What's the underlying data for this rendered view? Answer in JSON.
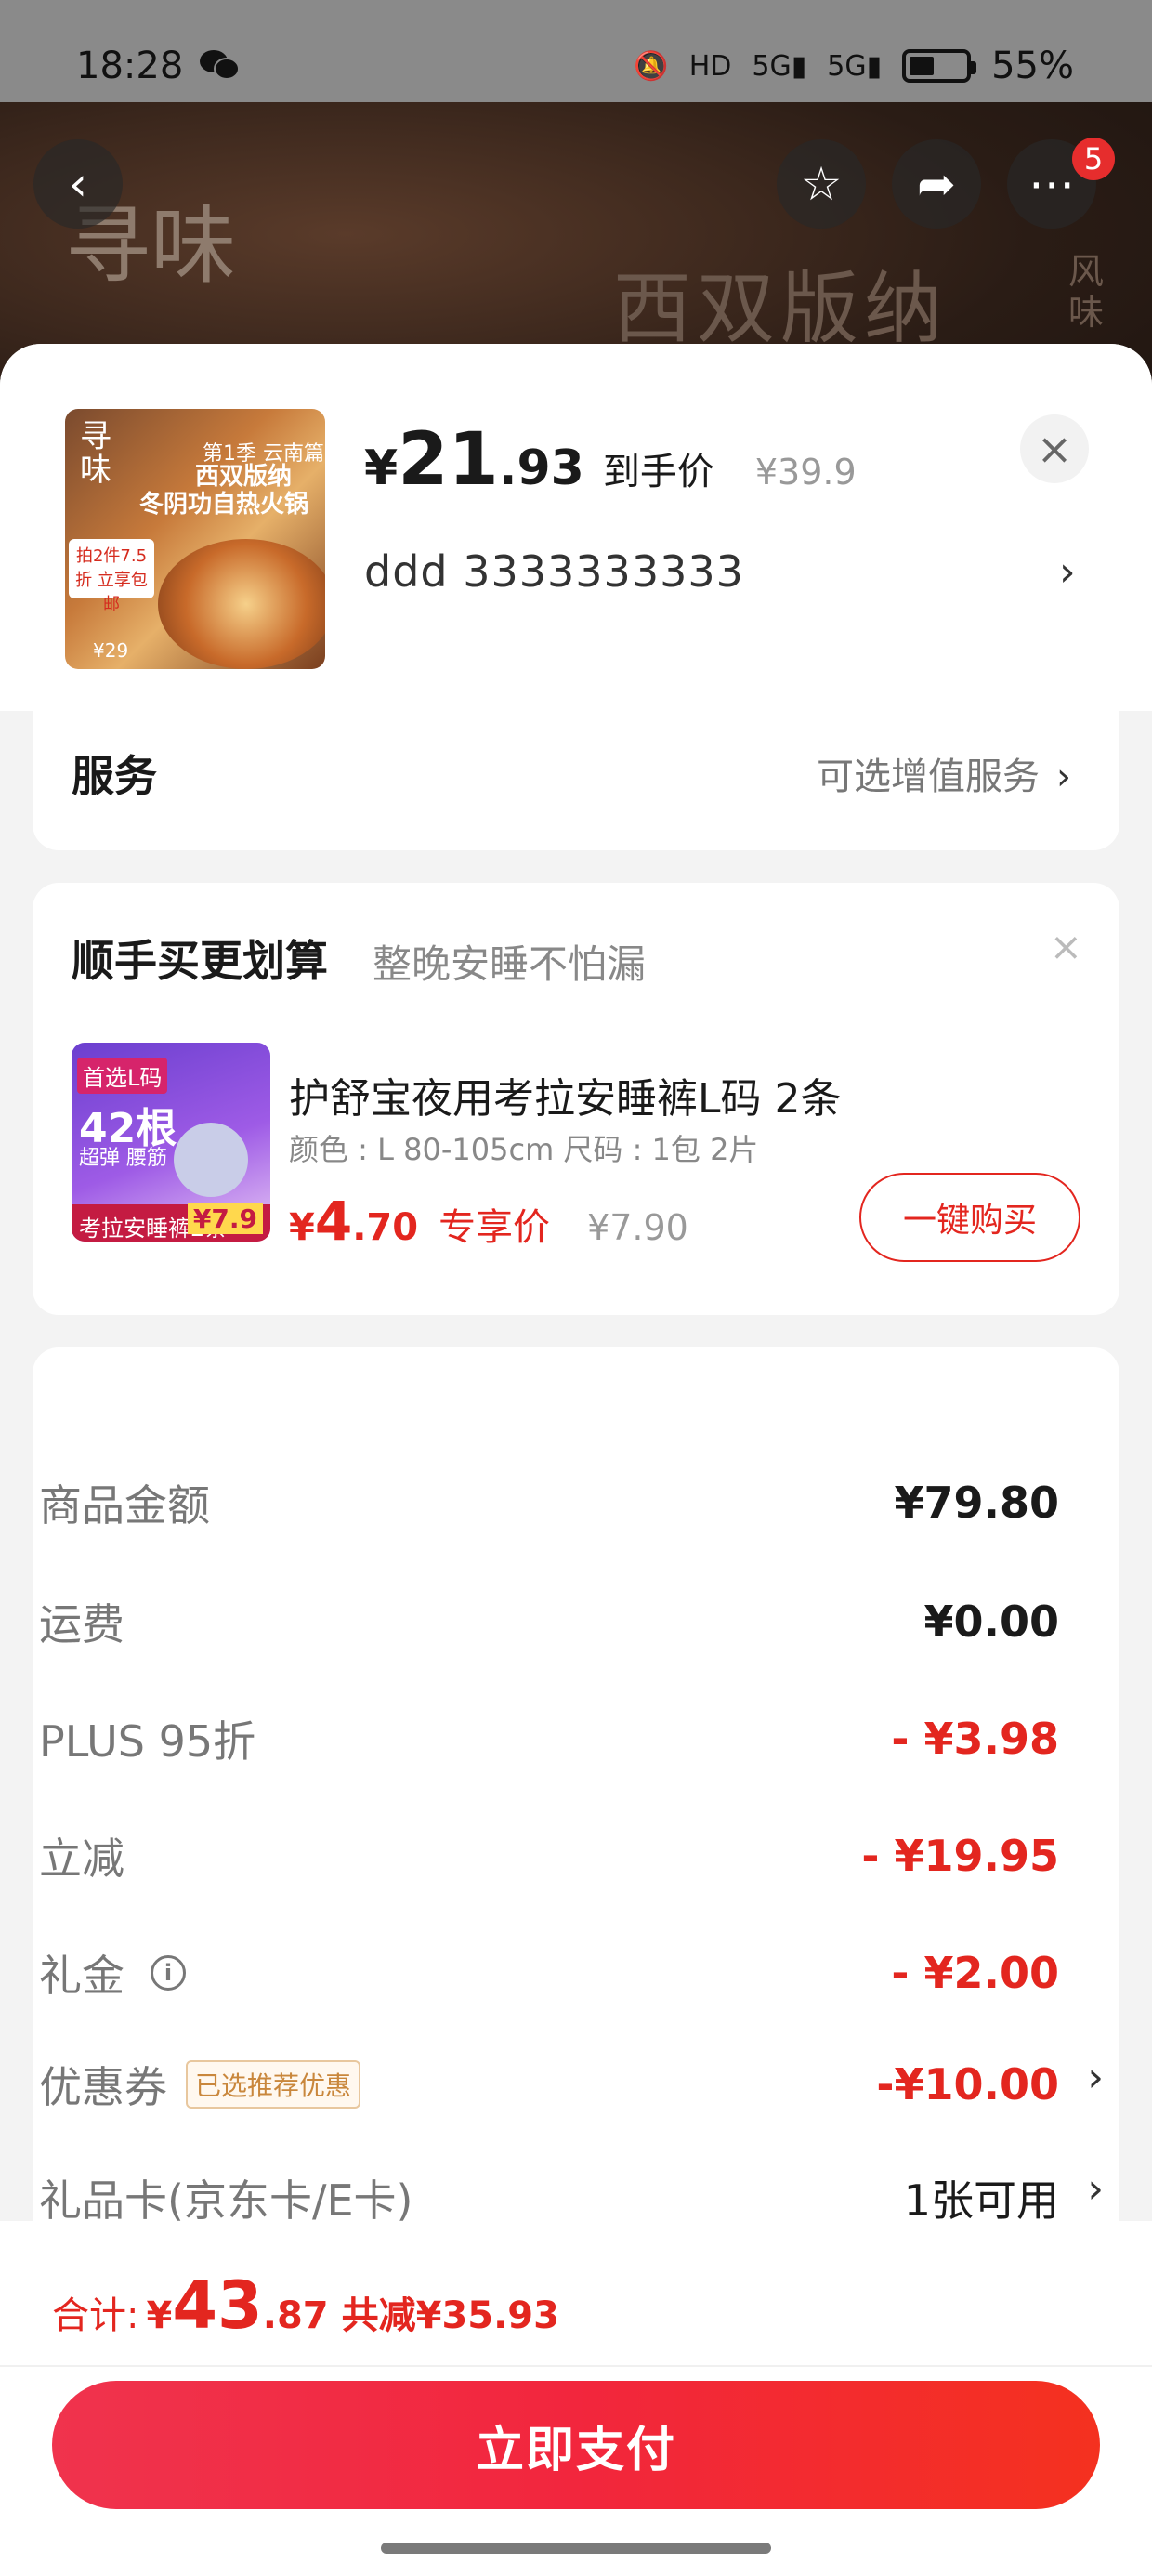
{
  "status_bar": {
    "time": "18:28",
    "battery": "55%",
    "network": "5G"
  },
  "banner": {
    "logo": "寻味",
    "title": "西双版纳",
    "subtitle": "风味",
    "badge_count": "5"
  },
  "product": {
    "price_yen": "¥",
    "price_int": "21",
    "price_dec": ".93",
    "price_label": "到手价",
    "original_price": "¥39.9",
    "spec": "ddd  3333333333",
    "thumb": {
      "brand": "寻味",
      "season": "第1季 云南篇",
      "line1": "西双版纳",
      "line2": "冬阴功自热火锅",
      "promo": "拍2件7.5折 立享包邮",
      "price_note": "¥29"
    }
  },
  "service": {
    "label": "服务",
    "option": "可选增值服务"
  },
  "upsell": {
    "title": "顺手买更划算",
    "subtitle": "整晚安睡不怕漏",
    "item_title": "护舒宝夜用考拉安睡裤L码 2条",
    "item_spec": "颜色 : L 80-105cm    尺码 : 1包 2片",
    "price_yen": "¥",
    "price_int": "4",
    "price_dec": ".70",
    "price_label": "专享价",
    "original_price": "¥7.90",
    "buy_button": "一键购买",
    "thumb": {
      "tag": "首选L码",
      "count": "42根",
      "desc": "超弹 腰筋",
      "strip": "考拉安睡裤2条",
      "price": "¥7.9"
    }
  },
  "summary": {
    "rows": [
      {
        "label": "商品金额",
        "value": "¥79.80"
      },
      {
        "label": "运费",
        "value": "¥0.00"
      },
      {
        "label": "PLUS 95折",
        "value": "- ¥3.98"
      },
      {
        "label": "立减",
        "value": "- ¥19.95"
      },
      {
        "label": "礼金",
        "value": "- ¥2.00"
      },
      {
        "label": "优惠券",
        "value": "-¥10.00",
        "tag": "已选推荐优惠"
      },
      {
        "label": "礼品卡(京东卡/E卡)",
        "value": "1张可用"
      }
    ]
  },
  "footer": {
    "total_label": "合计:",
    "total_yen": "¥",
    "total_int": "43",
    "total_dec": ".87",
    "saved": "共减¥35.93",
    "pay_button": "立即支付"
  },
  "colors": {
    "accent_red": "#e3261f",
    "tag_gold": "#c9873c"
  }
}
